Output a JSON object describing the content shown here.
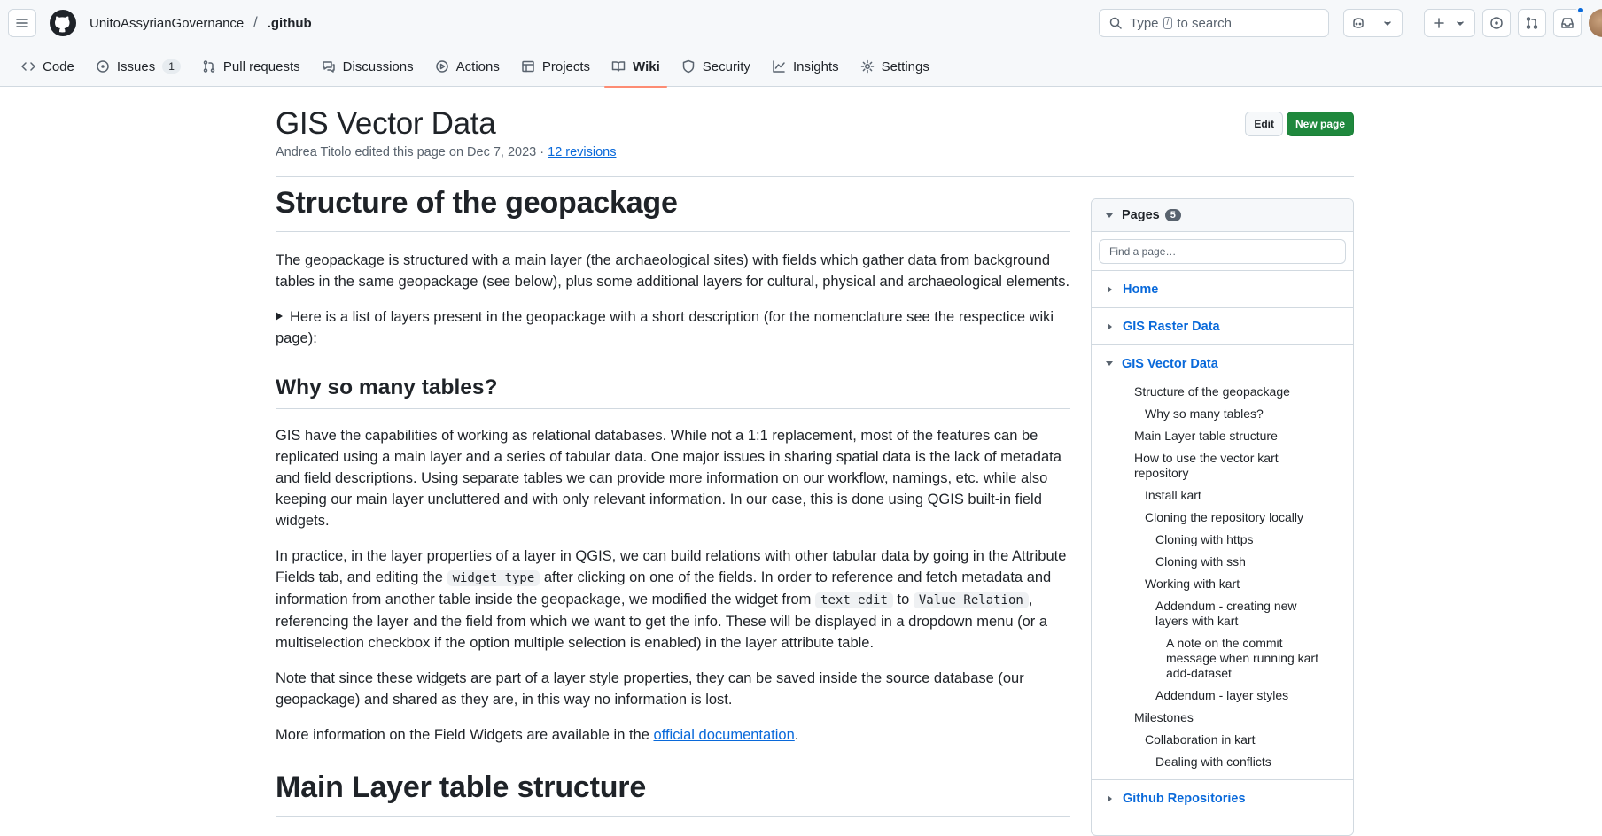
{
  "header": {
    "owner": "UnitoAssyrianGovernance",
    "separator": "/",
    "repo": ".github",
    "search": {
      "prefix": "Type",
      "key": "/",
      "suffix": "to search"
    },
    "icons": [
      "hamburger-icon",
      "github-logo",
      "search-icon",
      "copilot-icon",
      "plus-icon",
      "issue-icon",
      "pull-request-icon",
      "inbox-icon"
    ]
  },
  "tabs": [
    {
      "label": "Code",
      "icon": "code-icon"
    },
    {
      "label": "Issues",
      "icon": "issue-icon",
      "count": "1"
    },
    {
      "label": "Pull requests",
      "icon": "pull-request-icon"
    },
    {
      "label": "Discussions",
      "icon": "discussions-icon"
    },
    {
      "label": "Actions",
      "icon": "play-icon"
    },
    {
      "label": "Projects",
      "icon": "table-icon"
    },
    {
      "label": "Wiki",
      "icon": "book-icon",
      "active": true
    },
    {
      "label": "Security",
      "icon": "shield-icon"
    },
    {
      "label": "Insights",
      "icon": "graph-icon"
    },
    {
      "label": "Settings",
      "icon": "gear-icon"
    }
  ],
  "page": {
    "title": "GIS Vector Data",
    "meta_prefix": "Andrea Titolo edited this page on Dec 7, 2023 ·",
    "revisions": "12 revisions",
    "edit_label": "Edit",
    "new_page_label": "New page"
  },
  "content": {
    "h1": "Structure of the geopackage",
    "p1": "The geopackage is structured with a main layer (the archaeological sites) with fields which gather data from background tables in the same geopackage (see below), plus some additional layers for cultural, physical and archaeological elements.",
    "details_summary": "Here is a list of layers present in the geopackage with a short description (for the nomenclature see the respectice wiki page):",
    "h2": "Why so many tables?",
    "p2": "GIS have the capabilities of working as relational databases. While not a 1:1 replacement, most of the features can be replicated using a main layer and a series of tabular data. One major issues in sharing spatial data is the lack of metadata and field descriptions. Using separate tables we can provide more information on our workflow, namings, etc. while also keeping our main layer uncluttered and with only relevant information. In our case, this is done using QGIS built-in field widgets.",
    "p3": {
      "a": "In practice, in the layer properties of a layer in QGIS, we can build relations with other tabular data by going in the Attribute Fields tab, and editing the",
      "code1": "widget type",
      "b": "after clicking on one of the fields. In order to reference and fetch metadata and information from another table inside the geopackage, we modified the widget from",
      "code2": "text edit",
      "c": "to",
      "code3": "Value Relation",
      "d": ", referencing the layer and the field from which we want to get the info. These will be displayed in a dropdown menu (or a multiselection checkbox if the option multiple selection is enabled) in the layer attribute table."
    },
    "p4": "Note that since these widgets are part of a layer style properties, they can be saved inside the source database (our geopackage) and shared as they are, in this way no information is lost.",
    "p5": {
      "a": "More information on the Field Widgets are available in the",
      "link": "official documentation",
      "b": "."
    },
    "h1_second": "Main Layer table structure"
  },
  "sidebar": {
    "title": "Pages",
    "count": "5",
    "find_placeholder": "Find a page…",
    "pages": [
      "Home",
      "GIS Raster Data",
      "GIS Vector Data",
      "Github Repositories"
    ],
    "toc": [
      {
        "text": "Structure of the geopackage",
        "level": 1
      },
      {
        "text": "Why so many tables?",
        "level": 2
      },
      {
        "text": "Main Layer table structure",
        "level": 1
      },
      {
        "text": "How to use the vector kart repository",
        "level": 1
      },
      {
        "text": "Install kart",
        "level": 2
      },
      {
        "text": "Cloning the repository locally",
        "level": 2
      },
      {
        "text": "Cloning with https",
        "level": 3
      },
      {
        "text": "Cloning with ssh",
        "level": 3
      },
      {
        "text": "Working with kart",
        "level": 2
      },
      {
        "text": "Addendum - creating new layers with kart",
        "level": 3
      },
      {
        "text": "A note on the commit message when running kart add-dataset",
        "level": 4
      },
      {
        "text": "Addendum - layer styles",
        "level": 3
      },
      {
        "text": "Milestones",
        "level": 1
      },
      {
        "text": "Collaboration in kart",
        "level": 2
      },
      {
        "text": "Dealing with conflicts",
        "level": 3
      }
    ]
  },
  "colors": {
    "accent": "#0969da",
    "primary_button": "#1f883d",
    "active_tab_underline": "#fd8c73"
  }
}
